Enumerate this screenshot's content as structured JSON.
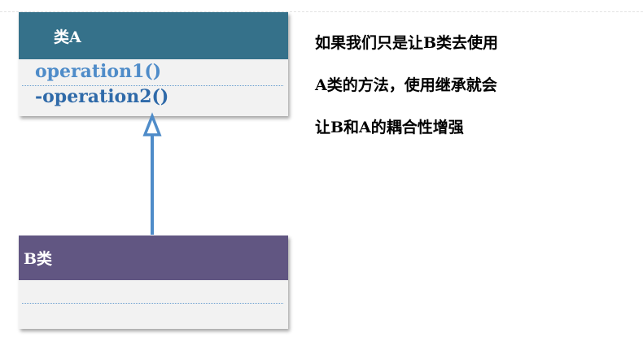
{
  "class_a": {
    "name": "类A",
    "operations": [
      "operation1()",
      "-operation2()"
    ],
    "header_color": "#35718a"
  },
  "class_b": {
    "name": "B类",
    "header_color": "#615682"
  },
  "relation": {
    "type": "generalization",
    "color": "#4f8cc9"
  },
  "note": {
    "lines": [
      "如果我们只是让B类去使用",
      "A类的方法，使用继承就会",
      "让B和A的耦合性增强"
    ]
  }
}
